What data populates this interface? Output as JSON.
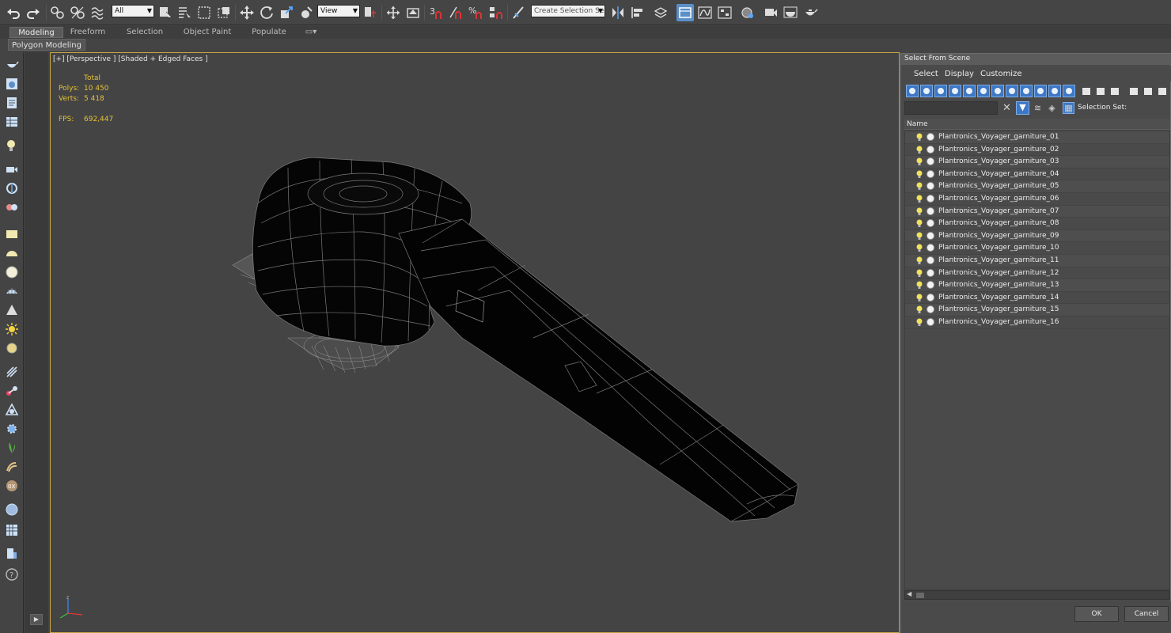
{
  "toolbar": {
    "selection_filter": "All",
    "reference_coord": "View",
    "named_selection_placeholder": "Create Selection Se",
    "snap_labels": [
      "3",
      "%"
    ]
  },
  "ribbon": {
    "tabs": [
      "Modeling",
      "Freeform",
      "Selection",
      "Object Paint",
      "Populate"
    ],
    "active_tab": "Modeling",
    "sub_panel": "Polygon Modeling"
  },
  "viewport": {
    "label": "[+] [Perspective ] [Shaded + Edged Faces ]",
    "stats": {
      "total_label": "Total",
      "polys_label": "Polys:",
      "polys_value": "10 450",
      "verts_label": "Verts:",
      "verts_value": "5 418",
      "fps_label": "FPS:",
      "fps_value": "692,447"
    },
    "axis_label": "z"
  },
  "dialog": {
    "title": "Select From Scene",
    "menu": [
      "Select",
      "Display",
      "Customize"
    ],
    "search_placeholder": "",
    "selection_set_label": "Selection Set:",
    "column_header": "Name",
    "objects": [
      "Plantronics_Voyager_garniture_01",
      "Plantronics_Voyager_garniture_02",
      "Plantronics_Voyager_garniture_03",
      "Plantronics_Voyager_garniture_04",
      "Plantronics_Voyager_garniture_05",
      "Plantronics_Voyager_garniture_06",
      "Plantronics_Voyager_garniture_07",
      "Plantronics_Voyager_garniture_08",
      "Plantronics_Voyager_garniture_09",
      "Plantronics_Voyager_garniture_10",
      "Plantronics_Voyager_garniture_11",
      "Plantronics_Voyager_garniture_12",
      "Plantronics_Voyager_garniture_13",
      "Plantronics_Voyager_garniture_14",
      "Plantronics_Voyager_garniture_15",
      "Plantronics_Voyager_garniture_16"
    ],
    "ok_label": "OK",
    "cancel_label": "Cancel"
  },
  "colors": {
    "accent": "#5a8fc8",
    "viewport_border": "#c9a646",
    "stats_text": "#e5c237",
    "viewport_bg": "#444444"
  }
}
